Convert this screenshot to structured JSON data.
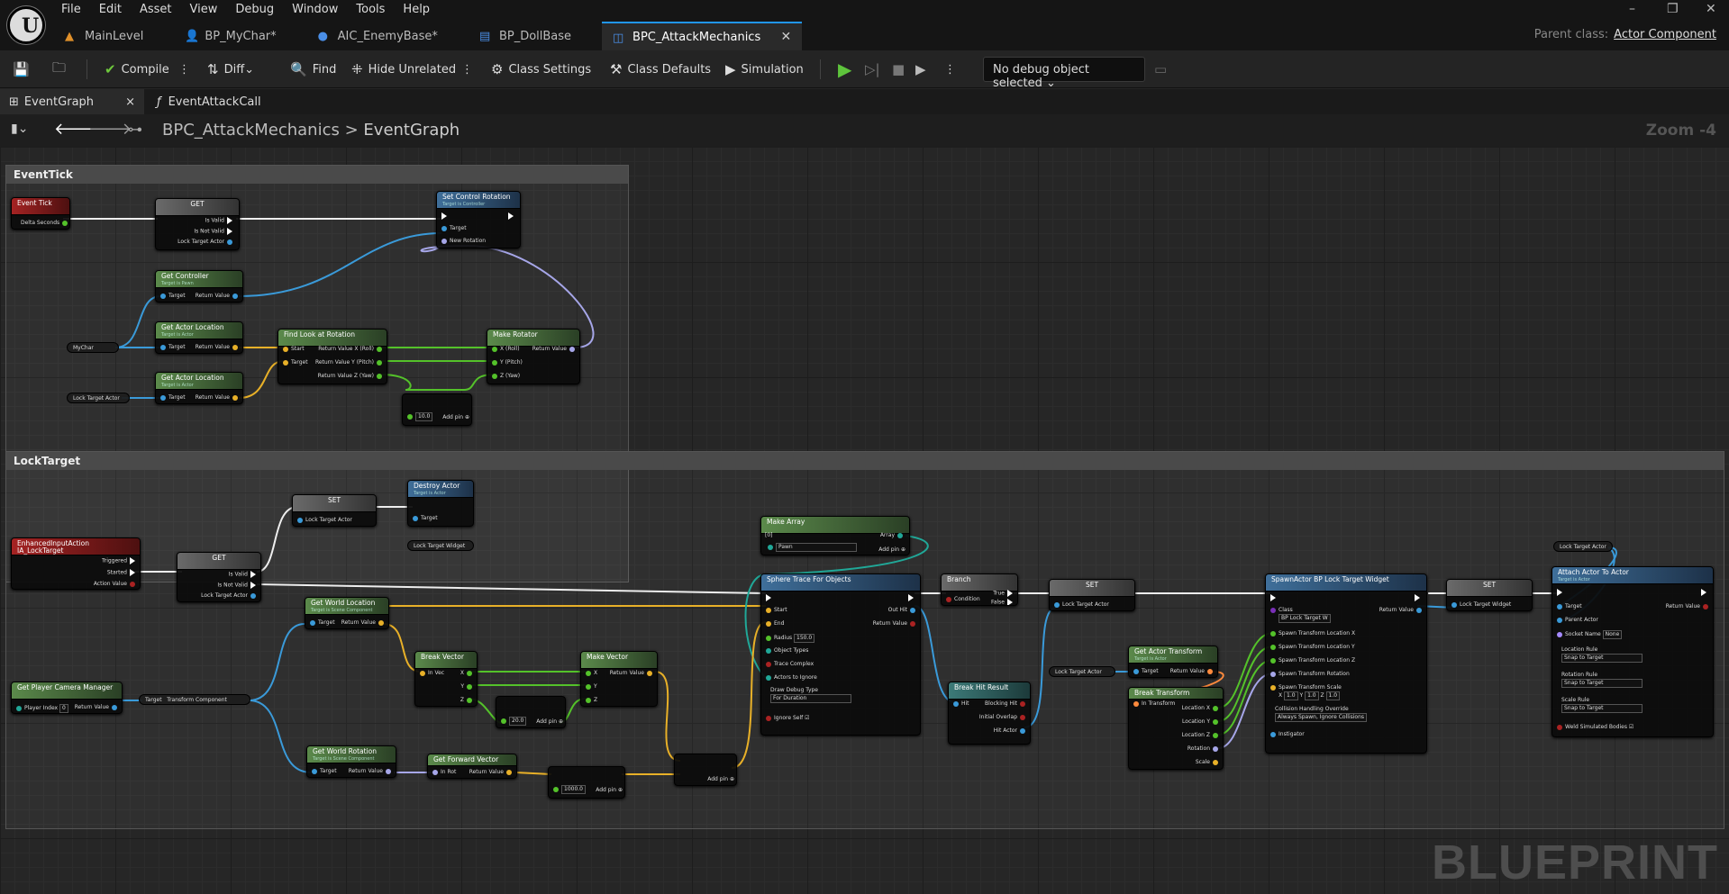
{
  "menu": [
    "File",
    "Edit",
    "Asset",
    "View",
    "Debug",
    "Window",
    "Tools",
    "Help"
  ],
  "tabs": [
    {
      "label": "MainLevel",
      "icon": "level-icon",
      "color": "#e0902a"
    },
    {
      "label": "BP_MyChar*",
      "icon": "character-icon",
      "color": "#4a8ee6"
    },
    {
      "label": "AIC_EnemyBase*",
      "icon": "ai-controller-icon",
      "color": "#4a8ee6"
    },
    {
      "label": "BP_DollBase",
      "icon": "blueprint-icon",
      "color": "#4a8ee6"
    },
    {
      "label": "BPC_AttackMechanics",
      "icon": "component-icon",
      "color": "#4a8ee6"
    }
  ],
  "window": {
    "minimize": "–",
    "maximize": "❐",
    "close": "✕"
  },
  "parent_class": {
    "label": "Parent class:",
    "value": "Actor Component"
  },
  "toolbar": {
    "compile": "Compile",
    "diff": "Diff",
    "find": "Find",
    "hide_unrelated": "Hide Unrelated",
    "class_settings": "Class Settings",
    "class_defaults": "Class Defaults",
    "simulation": "Simulation",
    "debug_object": "No debug object selected"
  },
  "doc_tabs": [
    {
      "label": "EventGraph",
      "close": "×"
    },
    {
      "label": "EventAttackCall"
    }
  ],
  "breadcrumb": {
    "root": "BPC_AttackMechanics",
    "sep": ">",
    "leaf": "EventGraph"
  },
  "zoom": "Zoom -4",
  "comments": {
    "event_tick": "EventTick",
    "lock_target": "LockTarget"
  },
  "nodes": {
    "event_tick": {
      "title": "Event Tick",
      "pins": [
        "Delta Seconds"
      ]
    },
    "get_tick": {
      "title": "GET",
      "pins": [
        "Is Valid",
        "Is Not Valid",
        "Lock Target Actor"
      ]
    },
    "set_control_rotation": {
      "title": "Set Control Rotation",
      "subtitle": "Target is Controller",
      "pins": [
        "Target",
        "New Rotation"
      ]
    },
    "get_controller": {
      "title": "Get Controller",
      "subtitle": "Target is Pawn",
      "pins": [
        "Target",
        "Return Value"
      ]
    },
    "get_actor_location_1": {
      "title": "Get Actor Location",
      "subtitle": "Target is Actor",
      "pins": [
        "Target",
        "Return Value"
      ]
    },
    "get_actor_location_2": {
      "title": "Get Actor Location",
      "subtitle": "Target is Actor",
      "pins": [
        "Target",
        "Return Value"
      ]
    },
    "find_look_at": {
      "title": "Find Look at Rotation",
      "pins": [
        "Start",
        "Target",
        "Return Value X (Roll)",
        "Return Value Y (Pitch)",
        "Return Value Z (Yaw)"
      ]
    },
    "make_rotator": {
      "title": "Make Rotator",
      "pins": [
        "X (Roll)",
        "Y (Pitch)",
        "Z (Yaw)",
        "Return Value"
      ]
    },
    "add_tick": {
      "value": "10.0",
      "pin": "Add pin"
    },
    "my_char": {
      "label": "MyChar"
    },
    "lock_target_var_1": {
      "label": "Lock Target Actor"
    },
    "input_action": {
      "title": "EnhancedInputAction IA_LockTarget",
      "pins": [
        "Triggered",
        "Started",
        "Action Value"
      ]
    },
    "get_lock": {
      "title": "GET",
      "pins": [
        "Is Valid",
        "Is Not Valid",
        "Lock Target Actor"
      ]
    },
    "set_1": {
      "title": "SET",
      "pins": [
        "Lock Target Actor"
      ]
    },
    "destroy_actor": {
      "title": "Destroy Actor",
      "subtitle": "Target is Actor",
      "pins": [
        "Target"
      ]
    },
    "lock_target_widget_var": {
      "label": "Lock Target Widget"
    },
    "make_array": {
      "title": "Make Array",
      "value": "[0]",
      "option": "Pawn",
      "pins": [
        "Array",
        "Add pin"
      ]
    },
    "get_world_location_1": {
      "title": "Get World Location",
      "subtitle": "Target is Scene Component",
      "pins": [
        "Target",
        "Return Value"
      ]
    },
    "break_vector": {
      "title": "Break Vector",
      "pins": [
        "In Vec",
        "X",
        "Y",
        "Z"
      ]
    },
    "make_vector": {
      "title": "Make Vector",
      "pins": [
        "X",
        "Y",
        "Z",
        "Return Value"
      ]
    },
    "add_20": {
      "value": "20.0",
      "pin": "Add pin"
    },
    "camera_manager": {
      "title": "Get Player Camera Manager",
      "pins": [
        "Player Index",
        "Return Value"
      ],
      "value": "0"
    },
    "transform_component": {
      "pins": [
        "Target",
        "Transform Component"
      ]
    },
    "get_world_rotation": {
      "title": "Get World Rotation",
      "subtitle": "Target is Scene Component",
      "pins": [
        "Target",
        "Return Value"
      ]
    },
    "get_forward_vector": {
      "title": "Get Forward Vector",
      "pins": [
        "In Rot",
        "Return Value"
      ]
    },
    "mult_1000": {
      "value": "1000.0",
      "pin": "Add pin"
    },
    "add_final": {
      "pin": "Add pin"
    },
    "sphere_trace": {
      "title": "Sphere Trace For Objects",
      "pins": [
        "Start",
        "End",
        "Radius",
        "Object Types",
        "Trace Complex",
        "Actors to Ignore",
        "Draw Debug Type",
        "Ignore Self",
        "Out Hit",
        "Return Value"
      ],
      "radius": "150.0",
      "draw": "For Duration"
    },
    "branch": {
      "title": "Branch",
      "pins": [
        "Condition",
        "True",
        "False"
      ]
    },
    "break_hit_result": {
      "title": "Break Hit Result",
      "pins": [
        "Hit",
        "Blocking Hit",
        "Initial Overlap",
        "Hit Actor"
      ]
    },
    "set_2": {
      "title": "SET",
      "pins": [
        "Lock Target Actor"
      ]
    },
    "lock_target_var_2": {
      "label": "Lock Target Actor"
    },
    "get_actor_transform": {
      "title": "Get Actor Transform",
      "subtitle": "Target is Actor",
      "pins": [
        "Target",
        "Return Value"
      ]
    },
    "break_transform": {
      "title": "Break Transform",
      "pins": [
        "In Transform",
        "Location X",
        "Location Y",
        "Location Z",
        "Rotation",
        "Scale"
      ]
    },
    "spawn_actor": {
      "title": "SpawnActor BP Lock Target Widget",
      "pins": [
        "Class",
        "Spawn Transform Location X",
        "Spawn Transform Location Y",
        "Spawn Transform Location Z",
        "Spawn Transform Rotation",
        "Spawn Transform Scale",
        "Collision Handling Override",
        "Instigator",
        "Return Value"
      ],
      "class": "BP Lock Target W",
      "collision": "Always Spawn, Ignore Collisions",
      "scale": [
        "1.0",
        "1.0",
        "1.0"
      ]
    },
    "set_3": {
      "title": "SET",
      "pins": [
        "Lock Target Widget"
      ]
    },
    "lock_target_var_3": {
      "label": "Lock Target Actor"
    },
    "attach_actor": {
      "title": "Attach Actor To Actor",
      "subtitle": "Target is Actor",
      "pins": [
        "Target",
        "Parent Actor",
        "Socket Name",
        "Location Rule",
        "Rotation Rule",
        "Scale Rule",
        "Weld Simulated Bodies",
        "Return Value"
      ],
      "socket": "None",
      "rule": "Snap to Target"
    }
  },
  "watermark": "BLUEPRINT"
}
